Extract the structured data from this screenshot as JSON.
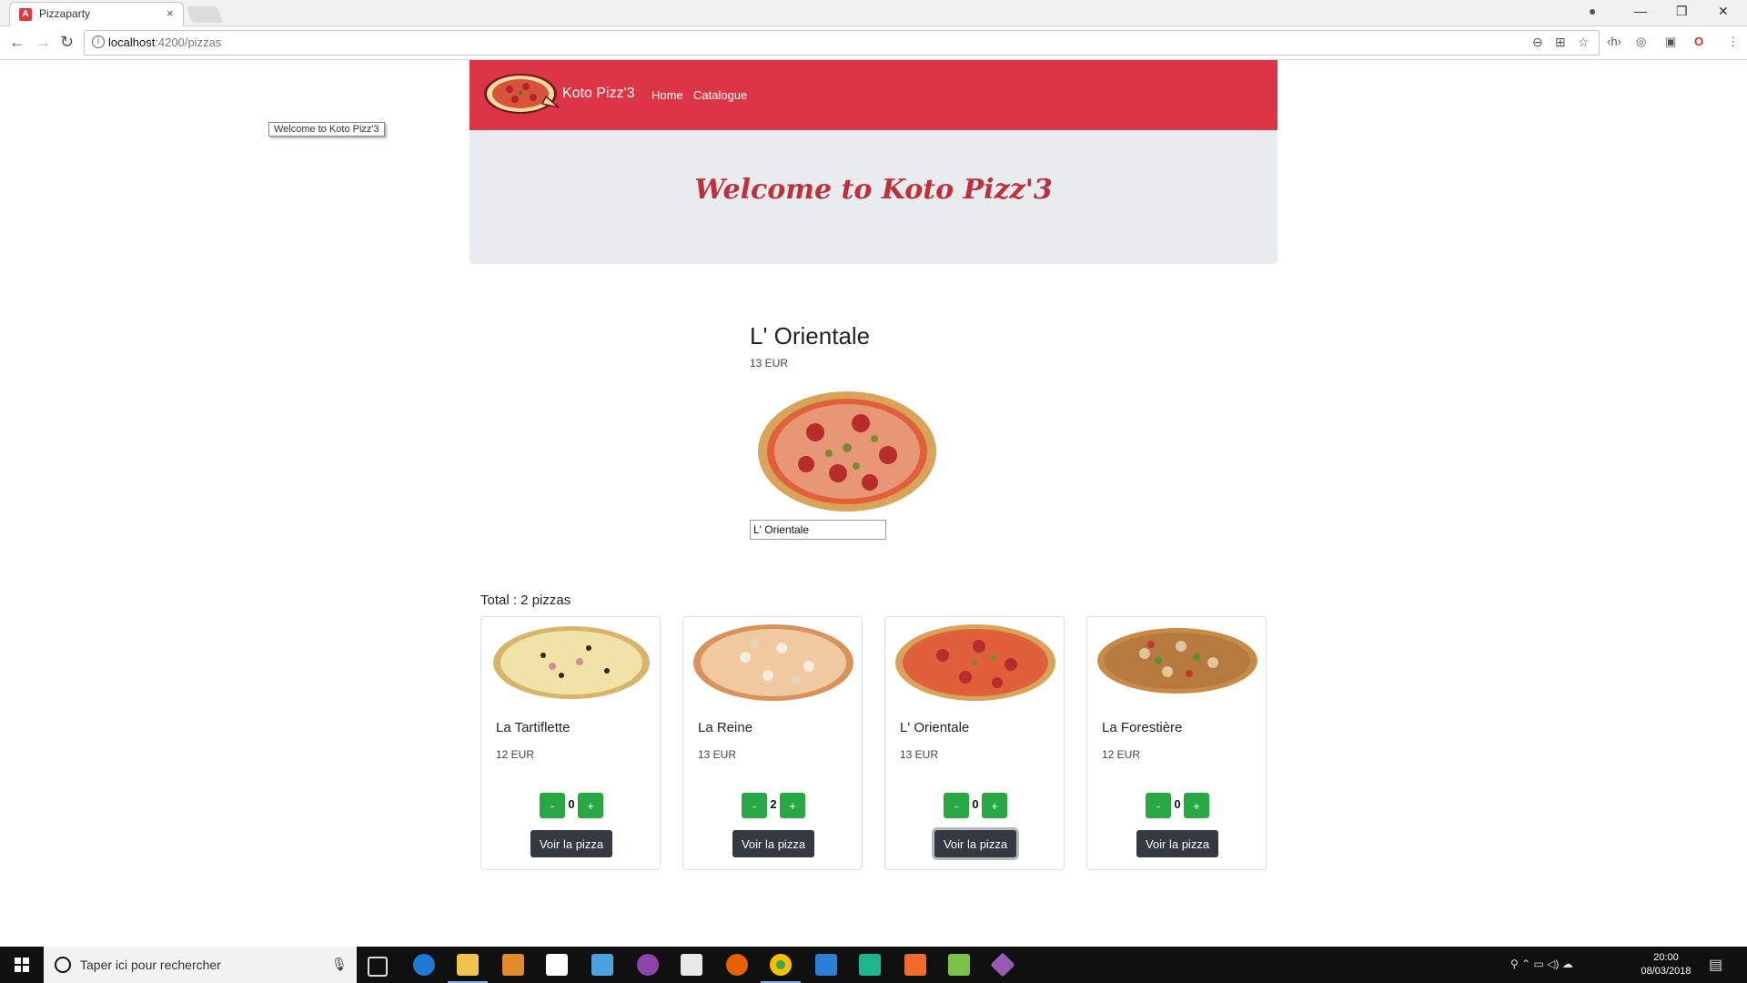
{
  "browser": {
    "tab_title": "Pizzaparty",
    "tab_close": "×",
    "url_host": "localhost",
    "url_rest": ":4200/pizzas",
    "controls": {
      "back": "←",
      "forward": "→",
      "reload": "↻",
      "minimize": "—",
      "maximize": "❐",
      "close": "✕",
      "profile": "●"
    },
    "omni_icons": {
      "zoom": "⊖",
      "translate": "⊞",
      "star": "☆"
    },
    "extensions": {
      "ext1": "‹h›",
      "ext2": "◎",
      "ext3": "▣",
      "ext4": "O",
      "menu": "⋮"
    }
  },
  "header": {
    "brand": "Koto Pizz'3",
    "nav": [
      {
        "label": "Home"
      },
      {
        "label": "Catalogue"
      }
    ]
  },
  "tooltip": "Welcome to Koto Pizz'3",
  "jumbotron": {
    "title": "Welcome to Koto Pizz'3"
  },
  "detail": {
    "name": "L' Orientale",
    "price": "13 EUR",
    "input_value": "L' Orientale"
  },
  "catalogue": {
    "total_label": "Total : 2 pizzas",
    "pizzas": [
      {
        "name": "La Tartiflette",
        "price": "12 EUR",
        "qty": "0",
        "minus": "-",
        "plus": "+",
        "view_label": "Voir la pizza"
      },
      {
        "name": "La Reine",
        "price": "13 EUR",
        "qty": "2",
        "minus": "-",
        "plus": "+",
        "view_label": "Voir la pizza"
      },
      {
        "name": "L' Orientale",
        "price": "13 EUR",
        "qty": "0",
        "minus": "-",
        "plus": "+",
        "view_label": "Voir la pizza"
      },
      {
        "name": "La Forestière",
        "price": "12 EUR",
        "qty": "0",
        "minus": "-",
        "plus": "+",
        "view_label": "Voir la pizza"
      }
    ]
  },
  "taskbar": {
    "search_placeholder": "Taper ici pour rechercher",
    "tray_icons": "⚲  ⌃  ▭  ◁)  ☁",
    "time": "20:00",
    "date": "08/03/2018",
    "notif": "▤"
  },
  "colors": {
    "navbar": "#dc3545",
    "jumbotron": "#e9ecef",
    "title": "#c0303c",
    "qty_button": "#28a745",
    "view_button": "#343a40"
  }
}
